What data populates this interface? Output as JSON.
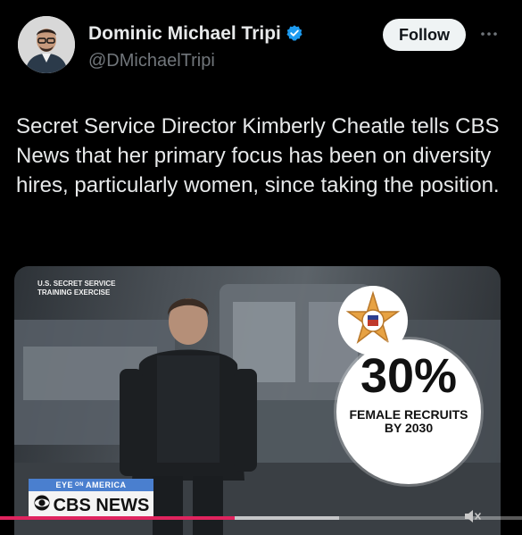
{
  "author": {
    "name": "Dominic Michael Tripi",
    "handle": "@DMichaelTripi",
    "verified": true,
    "verified_color": "#1d9bf0"
  },
  "actions": {
    "follow_label": "Follow",
    "more_icon": "more-icon"
  },
  "tweet": {
    "text": "Secret Service Director Kimberly Cheatle tells CBS News that her primary focus has been on diversity hires, particularly women, since taking the position."
  },
  "media": {
    "overlay_label_line1": "U.S. SECRET SERVICE",
    "overlay_label_line2": "TRAINING EXERCISE",
    "stat_value": "30%",
    "stat_line1": "FEMALE RECRUITS",
    "stat_line2": "BY 2030",
    "eye_label_left": "EYE",
    "eye_label_mid": "ON",
    "eye_label_right": "AMERICA",
    "network_label": "CBS NEWS",
    "progress_fraction": 0.45,
    "buffer_fraction": 0.65,
    "progress_color": "#e0245e",
    "muted": true
  }
}
